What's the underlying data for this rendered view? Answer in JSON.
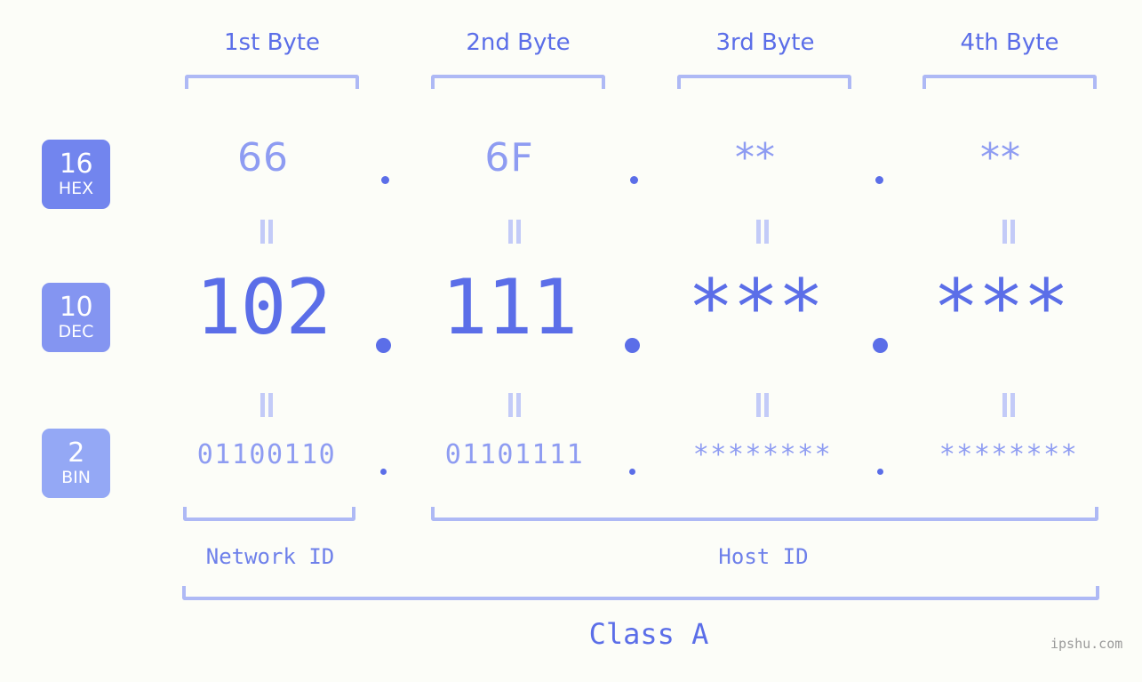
{
  "background_color": "#fcfdf8",
  "accent_colors": {
    "strong_blue": "#5b6ee8",
    "mid_blue": "#8e9cf2",
    "light_blue": "#aeb9f5",
    "badge_hex": "#7285ee",
    "badge_dec": "#8495f1",
    "badge_bin": "#94a8f5",
    "watermark_gray": "#9a9a9a"
  },
  "byte_headers": [
    {
      "label": "1st Byte"
    },
    {
      "label": "2nd Byte"
    },
    {
      "label": "3rd Byte"
    },
    {
      "label": "4th Byte"
    }
  ],
  "radix_badges": [
    {
      "number": "16",
      "name": "HEX"
    },
    {
      "number": "10",
      "name": "DEC"
    },
    {
      "number": "2",
      "name": "BIN"
    }
  ],
  "rows": {
    "hex": {
      "values": [
        "66",
        "6F",
        "**",
        "**"
      ]
    },
    "dec": {
      "values": [
        "102",
        "111",
        "***",
        "***"
      ]
    },
    "bin": {
      "values": [
        "01100110",
        "01101111",
        "********",
        "********"
      ]
    }
  },
  "separator": ".",
  "equality_symbol": "||",
  "id_labels": [
    {
      "label": "Network ID"
    },
    {
      "label": "Host ID"
    }
  ],
  "class_label": "Class A",
  "watermark": "ipshu.com"
}
